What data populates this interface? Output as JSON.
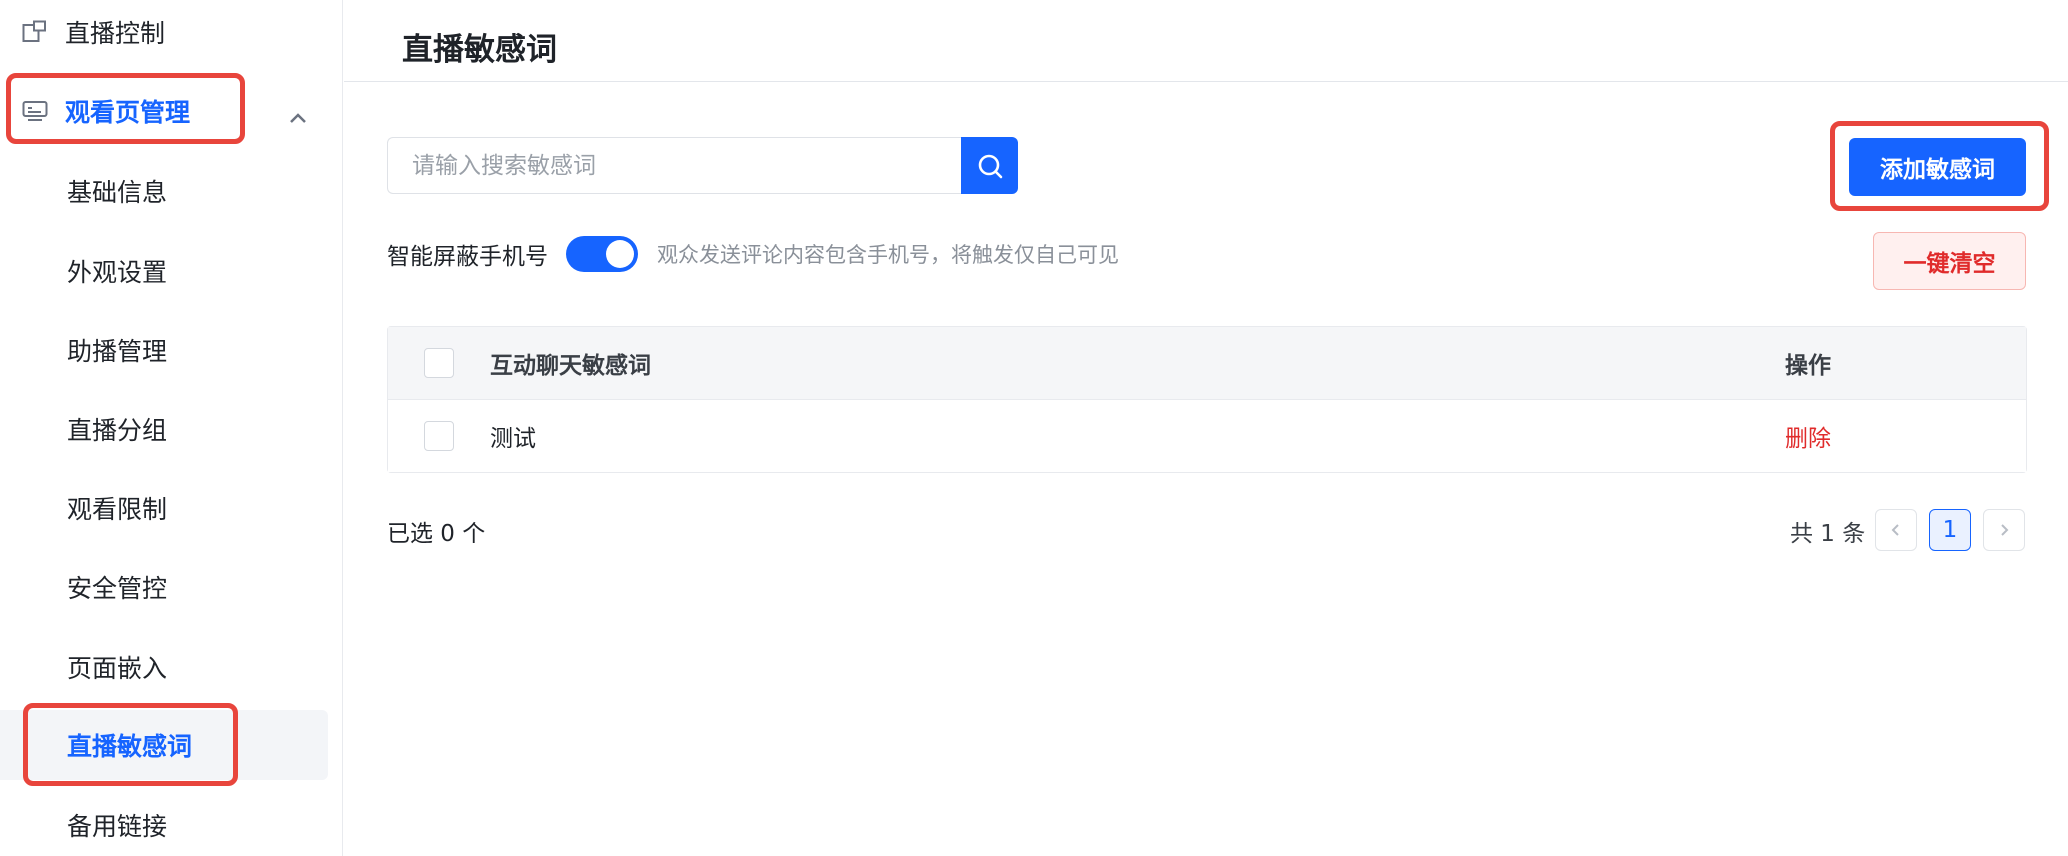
{
  "sidebar": {
    "live_control": "直播控制",
    "watch_page": "观看页管理",
    "items": [
      "基础信息",
      "外观设置",
      "助播管理",
      "直播分组",
      "观看限制",
      "安全管控",
      "页面嵌入",
      "直播敏感词",
      "备用链接"
    ]
  },
  "header": {
    "title": "直播敏感词"
  },
  "search": {
    "placeholder": "请输入搜索敏感词",
    "value": ""
  },
  "buttons": {
    "add": "添加敏感词",
    "clear": "一键清空"
  },
  "toggle": {
    "label": "智能屏蔽手机号",
    "on": true,
    "description": "观众发送评论内容包含手机号，将触发仅自己可见"
  },
  "table": {
    "columns": [
      "互动聊天敏感词",
      "操作"
    ],
    "rows": [
      {
        "word": "测试",
        "action": "删除"
      }
    ]
  },
  "footer": {
    "selected": "已选 0 个",
    "total": "共 1 条",
    "current_page": "1"
  },
  "colors": {
    "accent": "#1664ff",
    "danger": "#e02b2b",
    "highlight": "#e8453c"
  },
  "icons": [
    "live-control-icon",
    "watch-page-icon",
    "chevron-up-icon",
    "search-icon",
    "chevron-left-icon",
    "chevron-right-icon"
  ]
}
